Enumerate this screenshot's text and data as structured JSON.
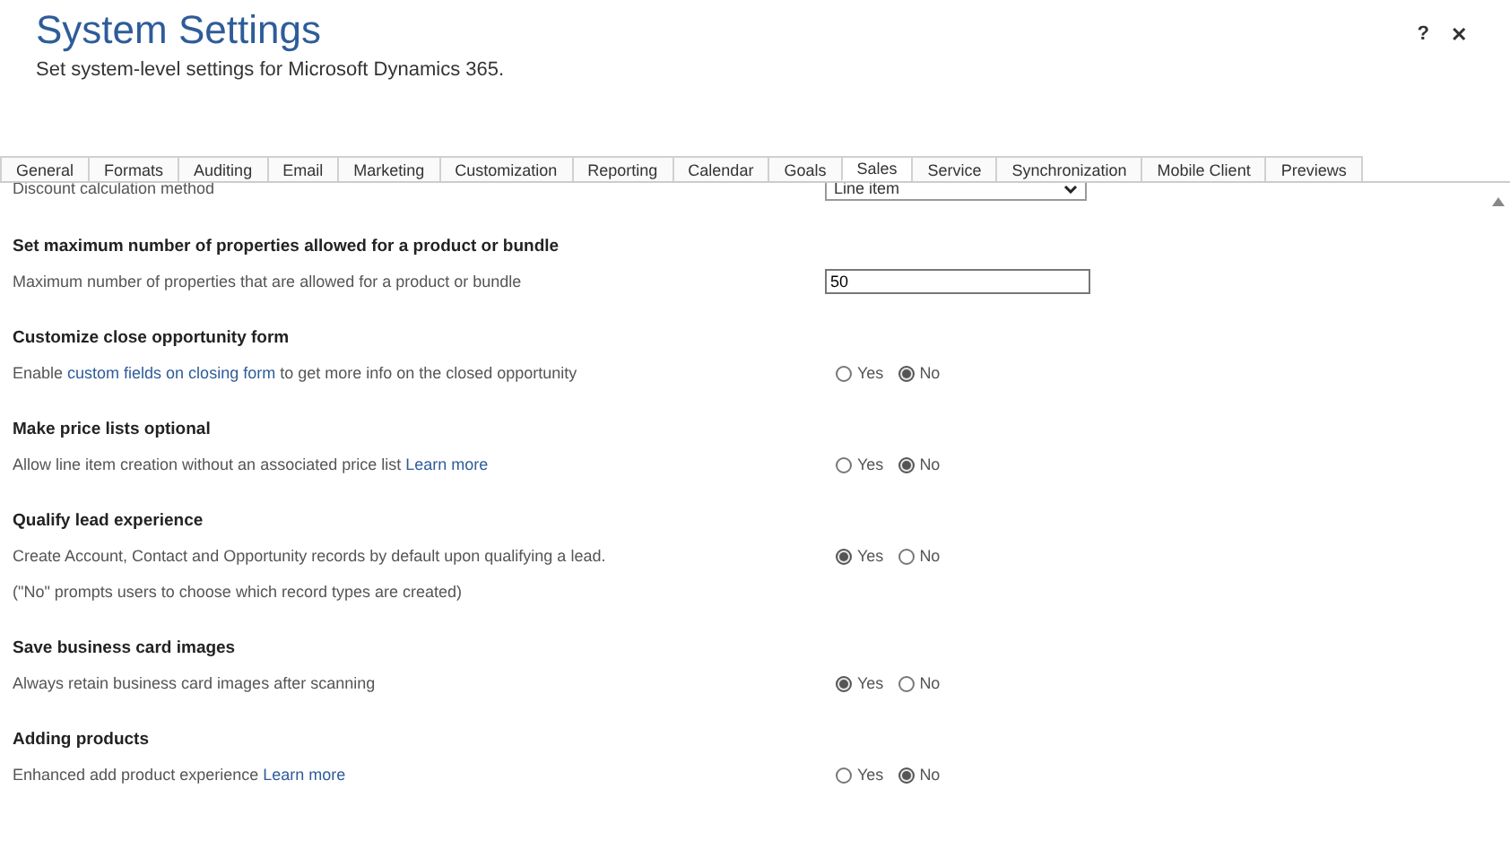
{
  "header": {
    "title": "System Settings",
    "subtitle": "Set system-level settings for Microsoft Dynamics 365.",
    "help": "?",
    "close": "✕"
  },
  "tabs": [
    {
      "label": "General",
      "selected": false
    },
    {
      "label": "Formats",
      "selected": false
    },
    {
      "label": "Auditing",
      "selected": false
    },
    {
      "label": "Email",
      "selected": false
    },
    {
      "label": "Marketing",
      "selected": false
    },
    {
      "label": "Customization",
      "selected": false
    },
    {
      "label": "Reporting",
      "selected": false
    },
    {
      "label": "Calendar",
      "selected": false
    },
    {
      "label": "Goals",
      "selected": false
    },
    {
      "label": "Sales",
      "selected": true
    },
    {
      "label": "Service",
      "selected": false
    },
    {
      "label": "Synchronization",
      "selected": false
    },
    {
      "label": "Mobile Client",
      "selected": false
    },
    {
      "label": "Previews",
      "selected": false
    }
  ],
  "top_row": {
    "label": "Discount calculation method",
    "value": "Line item"
  },
  "sections": [
    {
      "heading": "Set maximum number of properties allowed for a product or bundle",
      "lines": [
        {
          "before": "Maximum number of properties that are allowed for a product or bundle"
        }
      ],
      "kind": "number",
      "value": "50"
    },
    {
      "heading": "Customize close opportunity form",
      "lines": [
        {
          "before": "Enable ",
          "link": "custom fields on closing form",
          "after": " to get more info on the closed opportunity"
        }
      ],
      "kind": "yesno",
      "options": [
        {
          "label": "Yes",
          "selected": false
        },
        {
          "label": "No",
          "selected": true
        }
      ]
    },
    {
      "heading": "Make price lists optional",
      "lines": [
        {
          "before": "Allow line item creation without an associated price list ",
          "link": "Learn more"
        }
      ],
      "kind": "yesno",
      "options": [
        {
          "label": "Yes",
          "selected": false
        },
        {
          "label": "No",
          "selected": true
        }
      ]
    },
    {
      "heading": "Qualify lead experience",
      "lines": [
        {
          "before": "Create Account, Contact and Opportunity records by default upon qualifying a lead."
        },
        {
          "before": "(\"No\" prompts users to choose which record types are created)"
        }
      ],
      "kind": "yesno",
      "options": [
        {
          "label": "Yes",
          "selected": true
        },
        {
          "label": "No",
          "selected": false
        }
      ]
    },
    {
      "heading": "Save business card images",
      "lines": [
        {
          "before": "Always retain business card images after scanning"
        }
      ],
      "kind": "yesno",
      "options": [
        {
          "label": "Yes",
          "selected": true
        },
        {
          "label": "No",
          "selected": false
        }
      ]
    },
    {
      "heading": "Adding products",
      "lines": [
        {
          "before": "Enhanced add product experience ",
          "link": "Learn more"
        }
      ],
      "kind": "yesno",
      "options": [
        {
          "label": "Yes",
          "selected": false
        },
        {
          "label": "No",
          "selected": true
        }
      ]
    }
  ]
}
